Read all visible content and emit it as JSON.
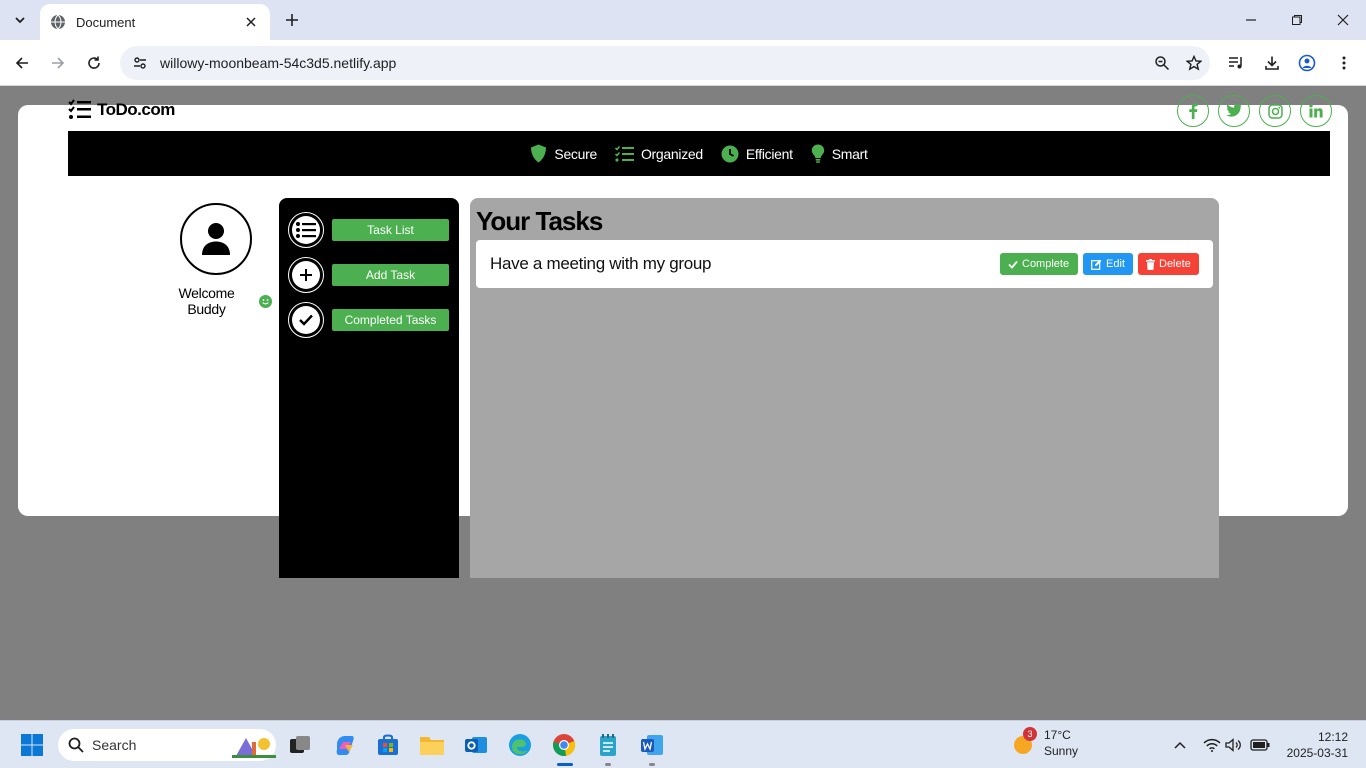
{
  "browser": {
    "tab_title": "Document",
    "url": "willowy-moonbeam-54c3d5.netlify.app"
  },
  "app": {
    "brand": "ToDo.com",
    "features": [
      {
        "label": "Secure",
        "icon": "shield-icon"
      },
      {
        "label": "Organized",
        "icon": "list-check-icon"
      },
      {
        "label": "Efficient",
        "icon": "clock-icon"
      },
      {
        "label": "Smart",
        "icon": "lightbulb-icon"
      }
    ],
    "socials": [
      "facebook-icon",
      "twitter-icon",
      "instagram-icon",
      "linkedin-icon"
    ],
    "profile": {
      "welcome": "Welcome Buddy"
    },
    "sidebar": {
      "items": [
        {
          "label": "Task List",
          "icon": "list-icon"
        },
        {
          "label": "Add Task",
          "icon": "plus-icon"
        },
        {
          "label": "Completed Tasks",
          "icon": "check-icon"
        }
      ]
    },
    "tasks": {
      "title": "Your Tasks",
      "items": [
        {
          "text": "Have a meeting with my group",
          "complete_label": "Complete",
          "edit_label": "Edit",
          "delete_label": "Delete"
        }
      ]
    },
    "colors": {
      "accent": "#4caf50",
      "edit": "#2196f3",
      "delete": "#f44336"
    }
  },
  "taskbar": {
    "search_placeholder": "Search",
    "weather": {
      "temp": "17°C",
      "condition": "Sunny",
      "badge": "3"
    },
    "clock": {
      "time": "12:12",
      "date": "2025-03-31"
    }
  }
}
